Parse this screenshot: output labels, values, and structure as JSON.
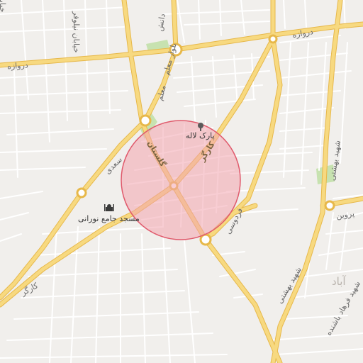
{
  "map": {
    "colors": {
      "background": "#f1efec",
      "minor_road": "#ffffff",
      "major_road_fill": "#f7d980",
      "major_road_casing": "#e7b84a",
      "park": "#c7e2b0",
      "radius_fill": "#f2a4ae",
      "radius_stroke": "#e05a6c"
    },
    "highlight_circle": {
      "shape": "circle",
      "note_color": "pink"
    },
    "labels": {
      "road_top_left_1": "خیابان ارغوان",
      "road_top_left_2": "خیابان نیلوفر",
      "road_darvazeh_left": "دروازه",
      "road_darvazeh_right": "دروازه",
      "road_moallem_top": "بلوار معلم",
      "road_moallem": "معلم",
      "road_daneshjoo": "دانش",
      "road_sadi": "سعدی",
      "road_golestan": "گلستان",
      "road_karegar_top": "کارگر",
      "road_karegar_bottom": "کارگر",
      "road_ferdowsi": "فردوسی",
      "road_shahid_beheshti_1": "شهید بهشتی",
      "road_shahid_beheshti_2": "شهید بهشتی",
      "road_parvin": "پروین",
      "road_farhad": "شهید فرهاد باشنده",
      "district_label": "آباد",
      "poi_park_laleh": "پارک لاله",
      "poi_mosque": "مسجد جامع نورانی"
    },
    "icons": {
      "park": "tree-icon",
      "mosque": "mosque-icon"
    }
  }
}
